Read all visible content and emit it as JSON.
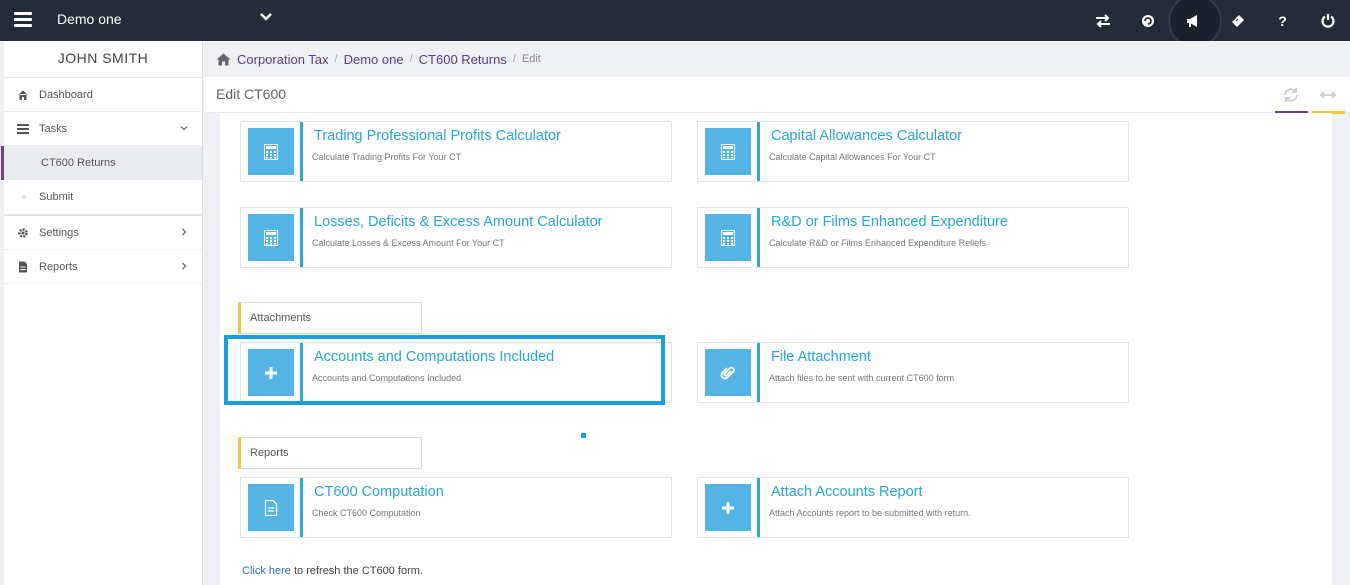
{
  "topbar": {
    "title": "Demo one",
    "icons": [
      "menu-icon",
      "chevron-down-icon",
      "swap-icon",
      "refresh-circle-icon",
      "megaphone-icon",
      "ticket-icon",
      "help-icon",
      "power-icon"
    ],
    "help_label": "?"
  },
  "sidebar": {
    "user_name": "JOHN SMITH",
    "items": [
      {
        "label": "Dashboard",
        "icon": "home-icon"
      },
      {
        "label": "Tasks",
        "icon": "tasks-icon"
      },
      {
        "label": "Settings",
        "icon": "gear-icon"
      },
      {
        "label": "Reports",
        "icon": "document-icon"
      }
    ],
    "subitems": [
      {
        "label": "CT600 Returns",
        "active": true
      },
      {
        "label": "Submit",
        "active": false
      }
    ]
  },
  "breadcrumb": {
    "items": [
      "Corporation Tax",
      "Demo one",
      "CT600 Returns"
    ],
    "current": "Edit",
    "separator": "/"
  },
  "header": {
    "title": "Edit CT600",
    "accent_colors": [
      "#6b3fa0",
      "#f4c542"
    ]
  },
  "cards": {
    "trading": {
      "title": "Trading Professional Profits Calculator",
      "subtitle": "Calculate Trading Profits For Your CT",
      "icon": "calculator-icon"
    },
    "capital": {
      "title": "Capital Allowances Calculator",
      "subtitle": "Calculate Capital Allowances For Your CT",
      "icon": "calculator-icon"
    },
    "losses": {
      "title": "Losses, Deficits & Excess Amount Calculator",
      "subtitle": "Calculate Losses & Excess Amount For Your CT",
      "icon": "calculator-icon"
    },
    "rnd": {
      "title": "R&D or Films Enhanced Expenditure",
      "subtitle": "Calculate R&D or Films Enhanced Expenditure Reliefs",
      "icon": "calculator-icon"
    },
    "accounts": {
      "title": "Accounts and Computations Included",
      "subtitle": "Accounts and Computations Included",
      "icon": "plus-icon"
    },
    "file": {
      "title": "File Attachment",
      "subtitle": "Attach files to be sent with current CT600 form",
      "icon": "paperclip-icon"
    },
    "computation": {
      "title": "CT600 Computation",
      "subtitle": "Check CT600 Computation",
      "icon": "document-icon"
    },
    "report": {
      "title": "Attach Accounts Report",
      "subtitle": "Attach Accounts report to be submitted with return.",
      "icon": "plus-icon"
    }
  },
  "sections": {
    "attachments": "Attachments",
    "reports": "Reports"
  },
  "footer": {
    "link": "Click here",
    "text": " to refresh the CT600 form."
  },
  "colors": {
    "topbar": "#242c3a",
    "brand_purple": "#5c3f8c",
    "accent_blue": "#27a6d8",
    "icon_box": "#54b4e3",
    "highlight": "#1a9fdc",
    "section_accent": "#f4c542"
  }
}
